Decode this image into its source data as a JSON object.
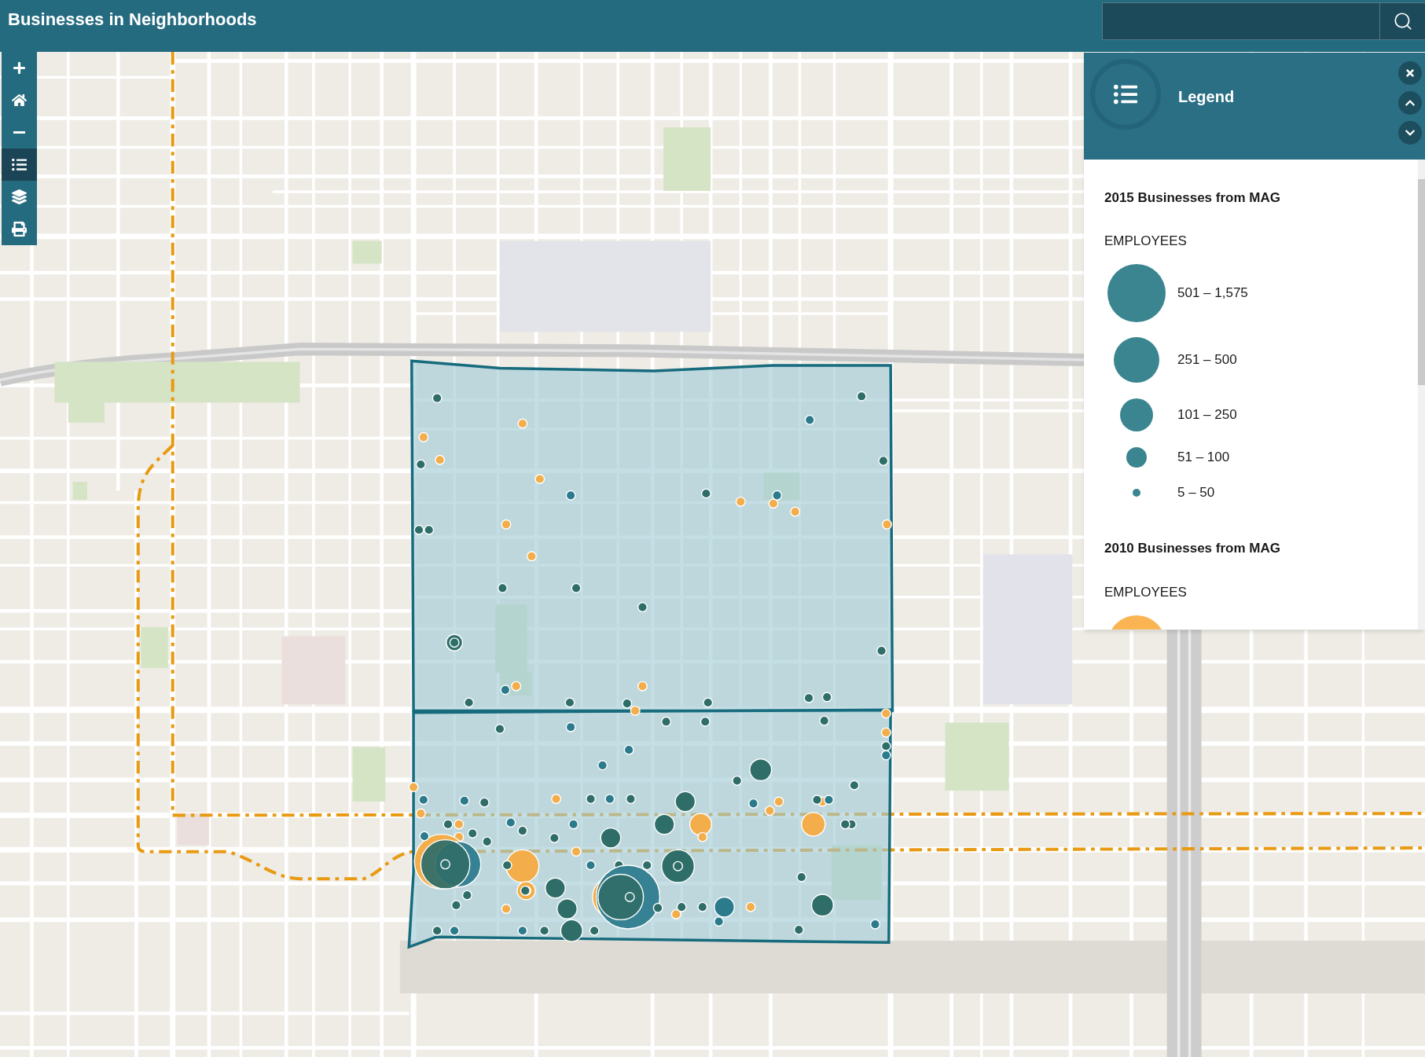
{
  "header": {
    "title": "Businesses in Neighborhoods"
  },
  "toolbar": [
    {
      "kind": "plus",
      "selected": false
    },
    {
      "kind": "home",
      "selected": false
    },
    {
      "kind": "minus",
      "selected": false
    },
    {
      "kind": "legend",
      "selected": true
    },
    {
      "kind": "layers",
      "selected": false
    },
    {
      "kind": "print",
      "selected": false
    }
  ],
  "legend": {
    "title": "Legend",
    "layers": [
      {
        "title": "2015 Businesses from MAG",
        "field": "EMPLOYEES",
        "color": "#3a8590",
        "classes": [
          "501 – 1,575",
          "251 – 500",
          "101 – 250",
          "51 – 100",
          "5 – 50"
        ]
      },
      {
        "title": "2010 Businesses from MAG",
        "field": "EMPLOYEES",
        "color": "#fbb452"
      }
    ]
  }
}
